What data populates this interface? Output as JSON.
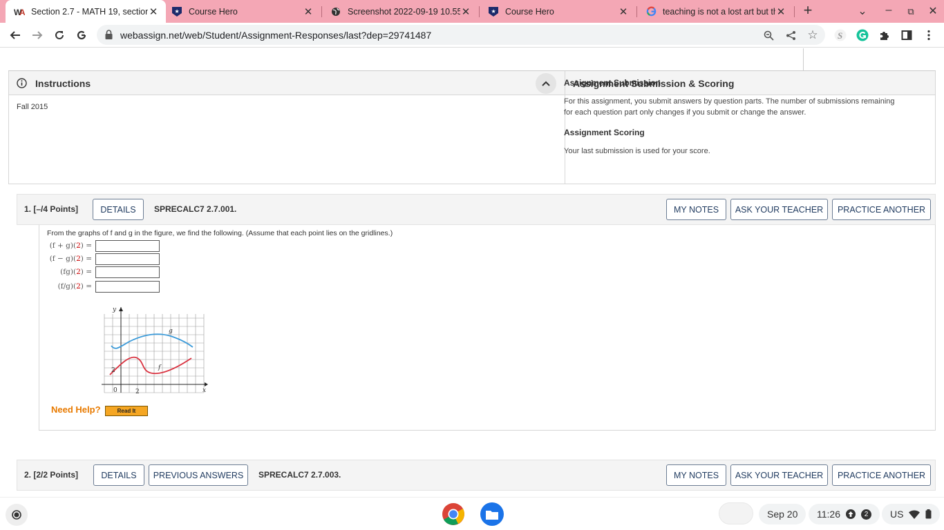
{
  "browser": {
    "tabs": [
      {
        "title": "Section 2.7 - MATH 19, section",
        "icon": "webassign-icon",
        "active": true
      },
      {
        "title": "Course Hero",
        "icon": "coursehero-icon",
        "active": false
      },
      {
        "title": "Screenshot 2022-09-19 10.55.",
        "icon": "globe-icon",
        "active": false
      },
      {
        "title": "Course Hero",
        "icon": "coursehero-icon",
        "active": false
      },
      {
        "title": "teaching is not a lost art but th",
        "icon": "google-icon",
        "active": false
      }
    ],
    "url": "webassign.net/web/Student/Assignment-Responses/last?dep=29741487",
    "tabstrip_color": "#f4a7b5"
  },
  "instructions": {
    "title": "Instructions",
    "body": "Fall 2015"
  },
  "submission": {
    "title": "Assignment Submission & Scoring",
    "sub1": "Assignment Submission",
    "p1": "For this assignment, you submit answers by question parts. The number of submissions remaining for each question part only changes if you submit or change the answer.",
    "sub2": "Assignment Scoring",
    "p2": "Your last submission is used for your score."
  },
  "q1": {
    "number": "1.  [–/4 Points]",
    "details": "DETAILS",
    "code": "SPRECALC7 2.7.001.",
    "my_notes": "MY NOTES",
    "ask_teacher": "ASK YOUR TEACHER",
    "practice": "PRACTICE ANOTHER",
    "prompt": "From the graphs of f and g in the figure, we find the following. (Assume that each point lies on the gridlines.)",
    "rows": [
      {
        "pre": "(f + g)(",
        "arg": "2",
        "post": ")  ="
      },
      {
        "pre": "(f − g)(",
        "arg": "2",
        "post": ")  ="
      },
      {
        "pre": "(fg)(",
        "arg": "2",
        "post": ")  ="
      },
      {
        "pre": "(f/g)(",
        "arg": "2",
        "post": ")  ="
      }
    ],
    "graph": {
      "y_label": "y",
      "x_label": "x",
      "g_label": "g",
      "f_label": "f",
      "tick_2y": "2",
      "tick_0": "0",
      "tick_2x": "2",
      "g_color": "#3a9ad9",
      "f_color": "#d9303e"
    },
    "need_help": "Need Help?",
    "read_it": "Read It"
  },
  "q2": {
    "number": "2.  [2/2 Points]",
    "details": "DETAILS",
    "prev": "PREVIOUS ANSWERS",
    "code": "SPRECALC7 2.7.003.",
    "my_notes": "MY NOTES",
    "ask_teacher": "ASK YOUR TEACHER",
    "practice": "PRACTICE ANOTHER"
  },
  "shelf": {
    "date": "Sep 20",
    "time": "11:26",
    "notif_count": "2",
    "locale": "US"
  }
}
